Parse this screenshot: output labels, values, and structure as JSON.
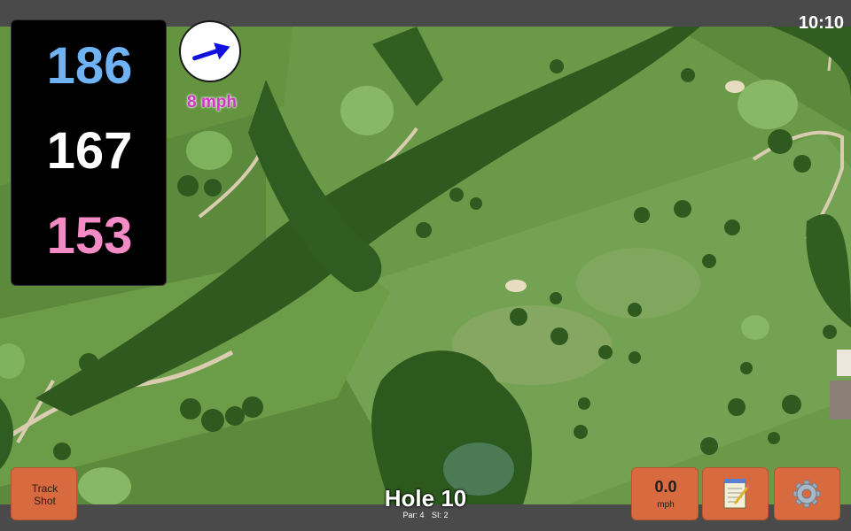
{
  "status_bar": {
    "time": "10:10"
  },
  "distances": {
    "back": "186",
    "middle": "167",
    "front": "153",
    "colors": {
      "back": "#6fb3f5",
      "middle": "#ffffff",
      "front": "#f58bc6"
    }
  },
  "wind": {
    "speed_label": "8 mph",
    "arrow_icon": "wind-direction-arrow",
    "arrow_color": "#1010e0",
    "label_color": "#d433c9"
  },
  "buttons": {
    "track_shot": {
      "line1": "Track",
      "line2": "Shot"
    },
    "wind_input": {
      "value": "0.0",
      "unit": "mph"
    },
    "notes": {
      "icon": "notepad-icon"
    },
    "settings": {
      "icon": "gear-icon"
    },
    "accent": "#d86a3f"
  },
  "hole": {
    "title": "Hole 10",
    "par": "Par: 4",
    "si": "SI: 2"
  },
  "map": {
    "type": "satellite golf course view"
  }
}
